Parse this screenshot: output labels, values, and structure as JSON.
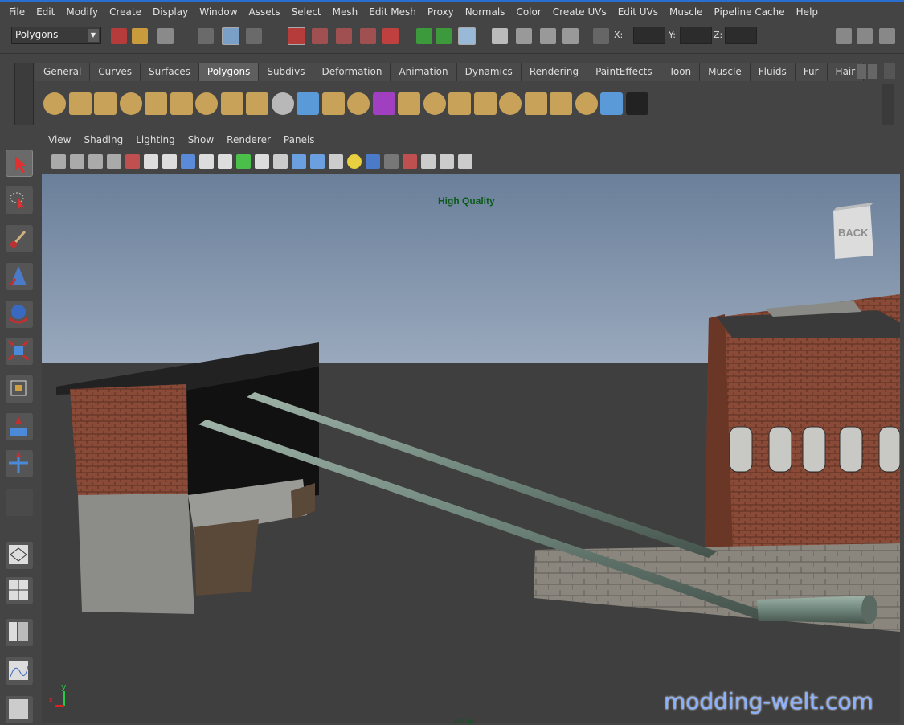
{
  "menubar": {
    "items": [
      "File",
      "Edit",
      "Modify",
      "Create",
      "Display",
      "Window",
      "Assets",
      "Select",
      "Mesh",
      "Edit Mesh",
      "Proxy",
      "Normals",
      "Color",
      "Create UVs",
      "Edit UVs",
      "Muscle",
      "Pipeline Cache",
      "Help"
    ]
  },
  "statusline": {
    "mode": "Polygons",
    "x_label": "X:",
    "y_label": "Y:",
    "z_label": "Z:"
  },
  "shelf": {
    "tabs": [
      "General",
      "Curves",
      "Surfaces",
      "Polygons",
      "Subdivs",
      "Deformation",
      "Animation",
      "Dynamics",
      "Rendering",
      "PaintEffects",
      "Toon",
      "Muscle",
      "Fluids",
      "Fur",
      "Hair"
    ],
    "active_tab": "Polygons",
    "icons": [
      "poly-sphere-icon",
      "poly-cube-icon",
      "poly-cylinder-icon",
      "poly-cone-icon",
      "poly-plane-icon",
      "poly-torus-icon",
      "poly-prism-icon",
      "poly-pyramid-icon",
      "poly-pipe-icon",
      "combine-icon",
      "separate-icon",
      "smooth-icon",
      "extrude-icon",
      "bridge-icon",
      "append-icon",
      "split-icon",
      "bevel-icon",
      "insert-edge-loop-icon",
      "merge-icon",
      "wedge-icon",
      "duplicate-face-icon",
      "extract-icon",
      "uv-editor-icon",
      "checker-icon"
    ]
  },
  "panel": {
    "menu": [
      "View",
      "Shading",
      "Lighting",
      "Show",
      "Renderer",
      "Panels"
    ]
  },
  "viewport": {
    "quality_label": "High Quality",
    "viewcube_label": "BACK",
    "camera_label": "persp",
    "axis_y": "y",
    "axis_x": "x"
  },
  "watermark": "modding-welt.com",
  "colors": {
    "ui_bg": "#444444",
    "sky_top": "#6a7f9a",
    "sky_bottom": "#9aa9bd",
    "ground": "#3e3e3e",
    "brick": "#8a4a38",
    "accent": "#2a6fd0"
  }
}
